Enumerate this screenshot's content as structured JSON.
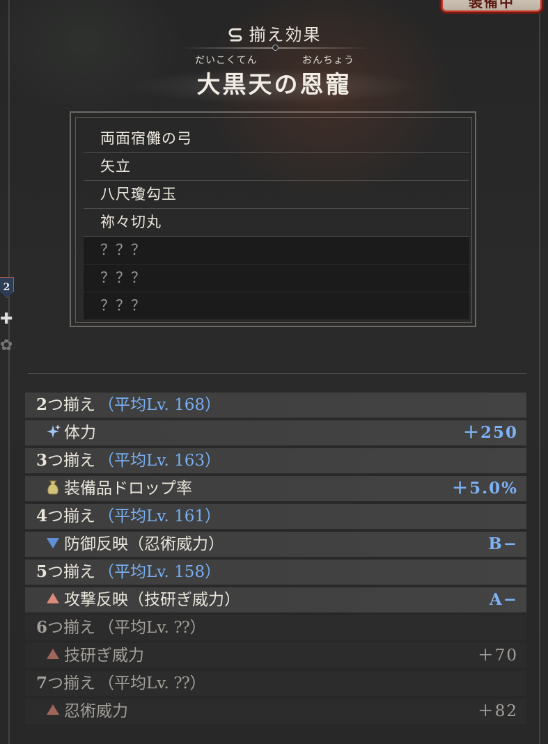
{
  "badge": {
    "label": "装備中"
  },
  "side": {
    "count": "2"
  },
  "header": {
    "title": "揃え効果",
    "set_name": "大黒天の恩寵",
    "furigana_left": "だいこくてん",
    "furigana_right": "おんちょう"
  },
  "items": [
    {
      "name": "両面宿儺の弓",
      "locked": false
    },
    {
      "name": "矢立",
      "locked": false
    },
    {
      "name": "八尺瓊勾玉",
      "locked": false
    },
    {
      "name": "祢々切丸",
      "locked": false
    },
    {
      "name": "？？？",
      "locked": true
    },
    {
      "name": "？？？",
      "locked": true
    },
    {
      "name": "？？？",
      "locked": true
    }
  ],
  "bonuses": [
    {
      "tier_count": "2",
      "tier_suffix": "つ揃え",
      "avg": "（平均Lv. 168）",
      "effect_icon": "sparkle-icon",
      "effect": "体力",
      "value": "＋250",
      "active": true
    },
    {
      "tier_count": "3",
      "tier_suffix": "つ揃え",
      "avg": "（平均Lv. 163）",
      "effect_icon": "pouch-icon",
      "effect": "装備品ドロップ率",
      "value": "＋5.0%",
      "active": true
    },
    {
      "tier_count": "4",
      "tier_suffix": "つ揃え",
      "avg": "（平均Lv. 161）",
      "effect_icon": "triangle-down-icon",
      "effect": "防御反映（忍術威力）",
      "value": "B−",
      "active": true
    },
    {
      "tier_count": "5",
      "tier_suffix": "つ揃え",
      "avg": "（平均Lv. 158）",
      "effect_icon": "triangle-up-icon",
      "effect": "攻撃反映（技研ぎ威力）",
      "value": "A−",
      "active": true
    },
    {
      "tier_count": "6",
      "tier_suffix": "つ揃え",
      "avg": "（平均Lv. ⁇）",
      "effect_icon": "triangle-up-icon",
      "effect": "技研ぎ威力",
      "value": "＋70",
      "active": false
    },
    {
      "tier_count": "7",
      "tier_suffix": "つ揃え",
      "avg": "（平均Lv. ⁇）",
      "effect_icon": "triangle-up-icon",
      "effect": "忍術威力",
      "value": "＋82",
      "active": false
    }
  ],
  "colors": {
    "accent_blue": "#7db2f5",
    "triangle_up": "#d98a7c",
    "triangle_down": "#5f8fd6",
    "pouch": "#d2c27a"
  }
}
